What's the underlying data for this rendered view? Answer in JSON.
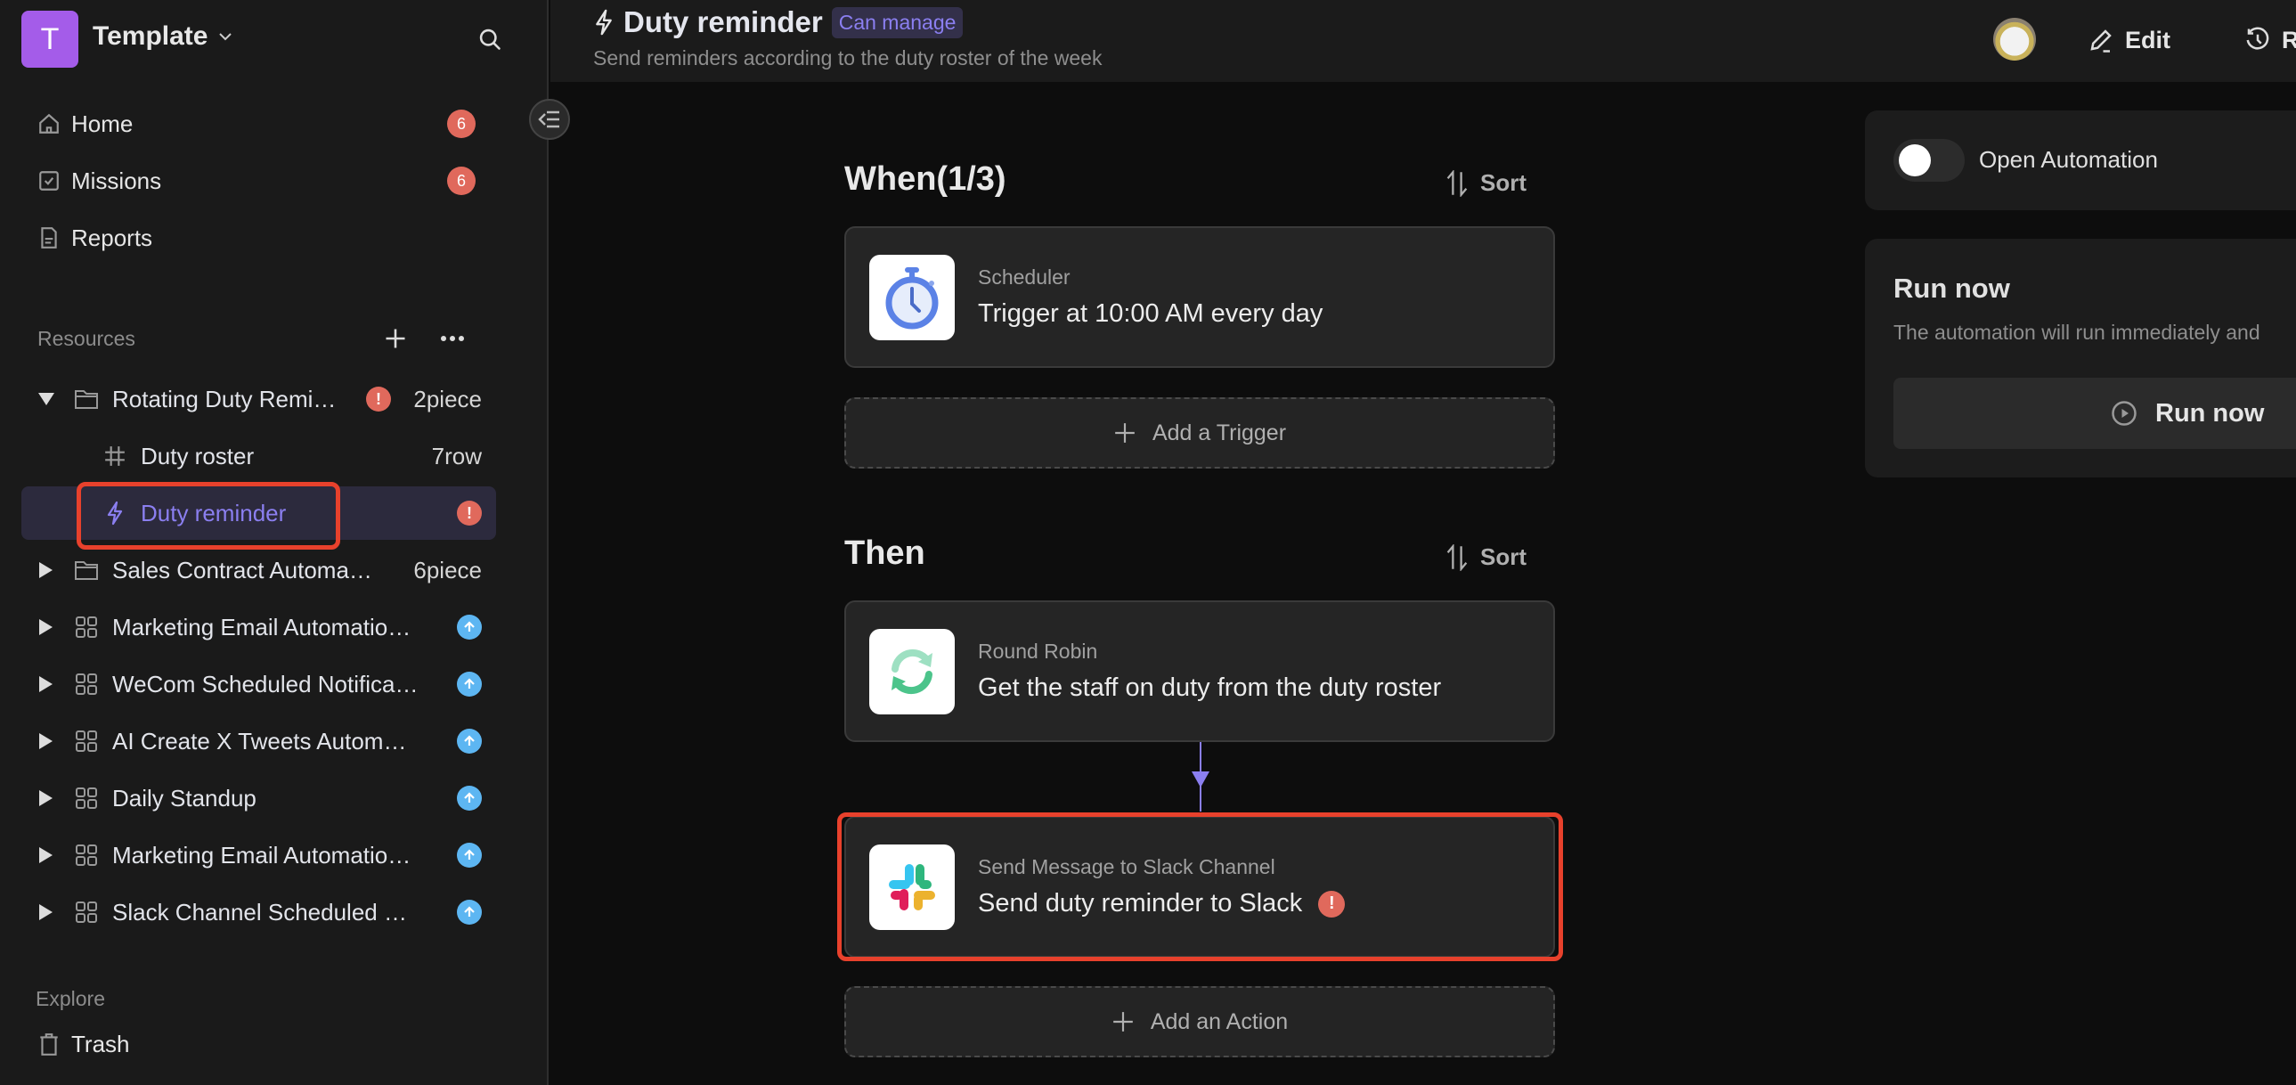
{
  "workspace": {
    "initial": "T",
    "name": "Template",
    "avatar_color": "#a45ce9"
  },
  "nav": [
    {
      "label": "Home",
      "icon": "home-icon",
      "badge": "6"
    },
    {
      "label": "Missions",
      "icon": "check-square-icon",
      "badge": "6"
    },
    {
      "label": "Reports",
      "icon": "document-icon",
      "badge": null
    }
  ],
  "resources": {
    "label": "Resources",
    "items": [
      {
        "label": "Rotating Duty Remi…",
        "icon": "folder-icon",
        "expanded": true,
        "error": true,
        "count": "2piece",
        "level": 0
      },
      {
        "label": "Duty roster",
        "icon": "hash-icon",
        "count": "7row",
        "level": 1
      },
      {
        "label": "Duty reminder",
        "icon": "lightning-icon",
        "error": true,
        "selected": true,
        "level": 1
      },
      {
        "label": "Sales Contract Automa…",
        "icon": "folder-icon",
        "count": "6piece",
        "level": 0
      },
      {
        "label": "Marketing Email Automatio…",
        "icon": "grid-icon",
        "upgrade": true,
        "level": 0
      },
      {
        "label": "WeCom Scheduled Notifica…",
        "icon": "grid-icon",
        "upgrade": true,
        "level": 0
      },
      {
        "label": "AI Create X Tweets Autom…",
        "icon": "grid-icon",
        "upgrade": true,
        "level": 0
      },
      {
        "label": "Daily Standup",
        "icon": "grid-icon",
        "upgrade": true,
        "level": 0
      },
      {
        "label": "Marketing Email Automatio…",
        "icon": "grid-icon",
        "upgrade": true,
        "level": 0
      },
      {
        "label": "Slack Channel Scheduled …",
        "icon": "grid-icon",
        "upgrade": true,
        "level": 0
      }
    ]
  },
  "explore": {
    "label": "Explore",
    "trash_label": "Trash"
  },
  "header": {
    "title": "Duty reminder",
    "permission": "Can manage",
    "subtitle": "Send reminders according to the duty roster of the week",
    "edit_label": "Edit",
    "history_label": "R"
  },
  "flow": {
    "when_title": "When(1/3)",
    "then_title": "Then",
    "sort_label": "Sort",
    "triggers": [
      {
        "type": "Scheduler",
        "description": "Trigger at 10:00 AM every day",
        "icon": "stopwatch-icon"
      }
    ],
    "add_trigger_label": "Add a Trigger",
    "actions": [
      {
        "type": "Round Robin",
        "description": "Get the staff on duty from the duty roster",
        "icon": "round-robin-icon",
        "error": false
      },
      {
        "type": "Send Message to Slack Channel",
        "description": "Send duty reminder to Slack",
        "icon": "slack-icon",
        "error": true
      }
    ],
    "add_action_label": "Add an Action",
    "accent": "#8b7ff0"
  },
  "panel": {
    "toggle_label": "Open Automation",
    "toggle_on": false,
    "run_title": "Run now",
    "run_desc": "The automation will run immediately and",
    "run_button": "Run now"
  },
  "colors": {
    "error": "#e0695c",
    "upgrade": "#5db6f2",
    "annotation": "#e8412c"
  }
}
